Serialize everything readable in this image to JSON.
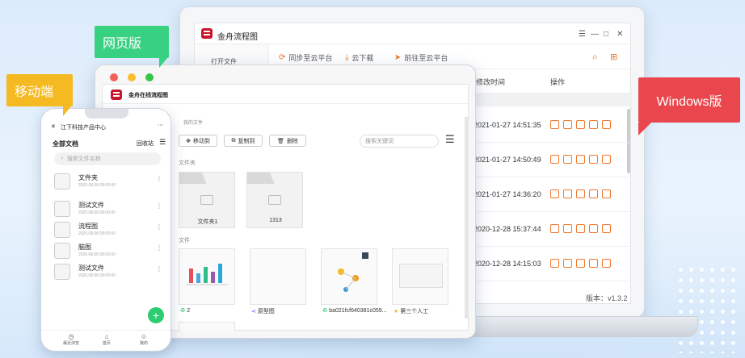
{
  "labels": {
    "web": "网页版",
    "mobile": "移动端",
    "windows": "Windows版"
  },
  "colors": {
    "web_tag": "#38d182",
    "mobile_tag": "#f5b921",
    "windows_tag": "#e9474d",
    "brand": "#c8162a",
    "accent": "#f0762a"
  },
  "windows_app": {
    "title": "金舟流程图",
    "window_controls": [
      "☰",
      "—",
      "□",
      "✕"
    ],
    "sidebar_item": "打开文件",
    "toolbar": [
      {
        "icon": "sync-icon",
        "label": "同步至云平台"
      },
      {
        "icon": "download-icon",
        "label": "云下载"
      },
      {
        "icon": "send-icon",
        "label": "前往至云平台"
      }
    ],
    "columns": {
      "modified": "修改时间",
      "actions": "操作"
    },
    "rows": [
      {
        "date": "2021-01-27 14:51:35"
      },
      {
        "date": "2021-01-27 14:50:49"
      },
      {
        "date": "2021-01-27 14:36:20"
      },
      {
        "date": "2020-12-28 15:37:44"
      },
      {
        "date": "2020-12-28 14:15:03"
      }
    ],
    "version": "版本：v1.3.2"
  },
  "web_app": {
    "title": "金舟在线流程图",
    "breadcrumb": "我的文件",
    "buttons": {
      "move": "移动到",
      "copy": "复制到",
      "delete": "删除"
    },
    "search_placeholder": "搜索关键词",
    "folders_section": "文件夹",
    "folders": [
      {
        "name": "文件夹1"
      },
      {
        "name": "1313"
      }
    ],
    "files_section": "文件",
    "files": [
      {
        "name": "2",
        "icon": "recycle-icon"
      },
      {
        "name": "原型图",
        "icon": "share-icon"
      },
      {
        "name": "ba021fcf640381c059...",
        "icon": "recycle-icon"
      },
      {
        "name": "第三个人工",
        "icon": "star-icon"
      }
    ]
  },
  "mobile_app": {
    "header": "江下科技产品中心",
    "section_title": "全部文档",
    "recent": "回收站",
    "search_placeholder": "搜索文件名称",
    "items": [
      {
        "name": "文件夹",
        "date": "2020.08.08  08:00:00"
      },
      {
        "name": "测试文件",
        "date": "2020.08.08  08:00:00"
      },
      {
        "name": "流程图",
        "date": "2020.08.08  08:00:00"
      },
      {
        "name": "脑图",
        "date": "2020.08.08  08:00:00"
      },
      {
        "name": "测试文件",
        "date": "2020.08.08  08:00:00"
      }
    ],
    "fab": "+",
    "nav": [
      {
        "label": "最近浏览"
      },
      {
        "label": "首页"
      },
      {
        "label": "我的"
      }
    ]
  }
}
